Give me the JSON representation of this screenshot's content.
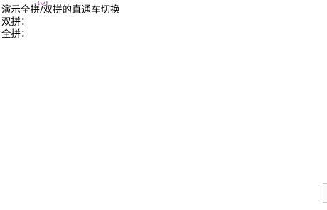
{
  "page": {
    "title": "演示全拼/双拼的直通车切换",
    "shuangpin_label": "双拼：",
    "shuangpin_value": "",
    "quanpin_label": "全拼：",
    "quanpin_value": ""
  },
  "icons": {
    "ime_indicator": "ime-status-icon"
  },
  "colors": {
    "background": "#ffffff",
    "text": "#000000",
    "ime_icon": "#b06ab3"
  }
}
